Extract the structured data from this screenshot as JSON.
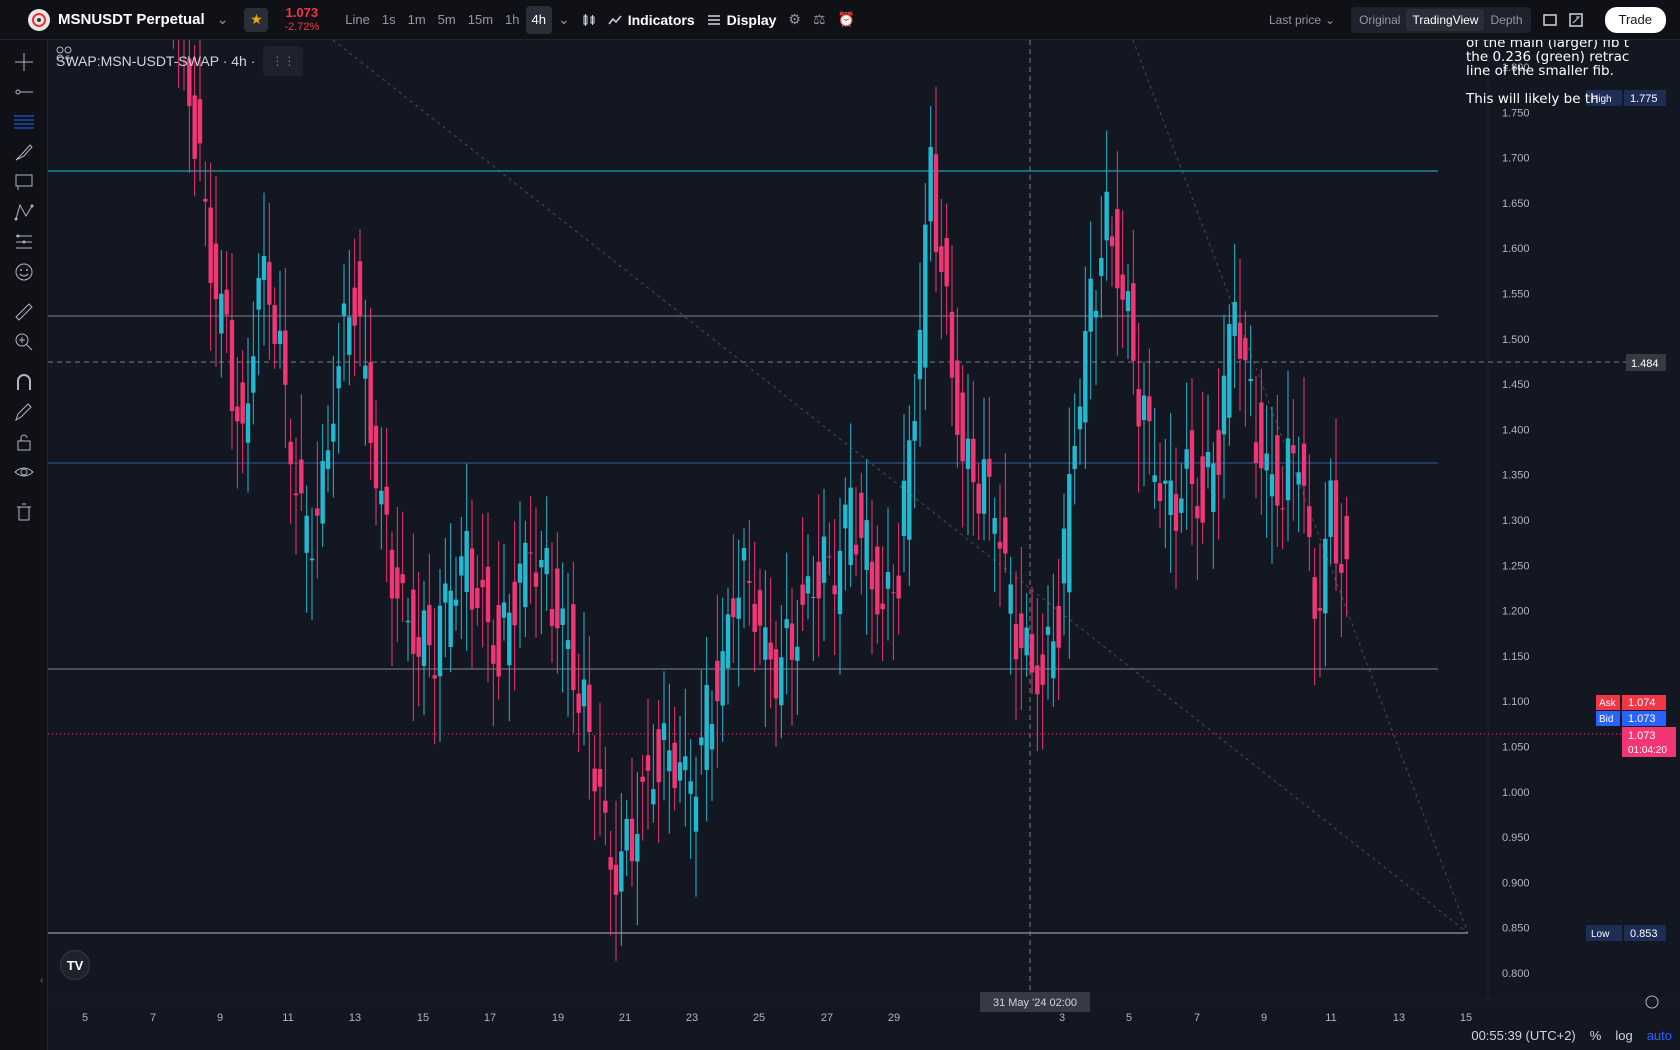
{
  "header": {
    "symbol": "MSNUSDT Perpetual",
    "price": "1.073",
    "change": "-2.72%",
    "intervals": [
      "Line",
      "1s",
      "1m",
      "5m",
      "15m",
      "1h",
      "4h"
    ],
    "active_interval": "4h",
    "indicators_label": "Indicators",
    "display_label": "Display",
    "price_source": "Last price",
    "views": [
      "Original",
      "TradingView",
      "Depth"
    ],
    "active_view": "TradingView",
    "trade_label": "Trade"
  },
  "chart": {
    "legend": "SWAP:MSN-USDT-SWAP · 4h ·",
    "note_lines": [
      "of the main (larger) fib t",
      "the 0.236 (green) retrac",
      "line of the smaller fib.",
      "",
      "This will likely be th"
    ],
    "y_ticks": [
      "1.800",
      "1.750",
      "1.700",
      "1.650",
      "1.600",
      "1.550",
      "1.500",
      "1.450",
      "1.400",
      "1.350",
      "1.300",
      "1.250",
      "1.200",
      "1.150",
      "1.100",
      "1.050",
      "1.000",
      "0.950",
      "0.900",
      "0.850",
      "0.800"
    ],
    "x_ticks": [
      "5",
      "7",
      "9",
      "11",
      "13",
      "15",
      "17",
      "19",
      "21",
      "23",
      "25",
      "27",
      "29",
      "3",
      "5",
      "7",
      "9",
      "11",
      "13",
      "15"
    ],
    "crosshair_time": "31 May '24   02:00",
    "crosshair_price": "1.484",
    "high_label": "High",
    "high_value": "1.775",
    "low_label": "Low",
    "low_value": "0.853",
    "ask_label": "Ask",
    "ask_value": "1.074",
    "bid_label": "Bid",
    "bid_value": "1.073",
    "last_price": "1.073",
    "countdown": "01:04:20",
    "colors": {
      "up": "#22b8cf",
      "down": "#f23674",
      "bg": "#131722"
    }
  },
  "footer": {
    "time": "00:55:39 (UTC+2)",
    "percent": "%",
    "log": "log",
    "auto": "auto"
  },
  "tools": [
    "crosshair-icon",
    "trend-line-icon",
    "fib-icon",
    "brush-icon",
    "text-icon",
    "pattern-icon",
    "forecast-icon",
    "emoji-icon",
    "ruler-icon",
    "zoom-icon",
    "magnet-icon",
    "pencil-lock-icon",
    "lock-icon",
    "eye-icon",
    "trash-icon"
  ]
}
